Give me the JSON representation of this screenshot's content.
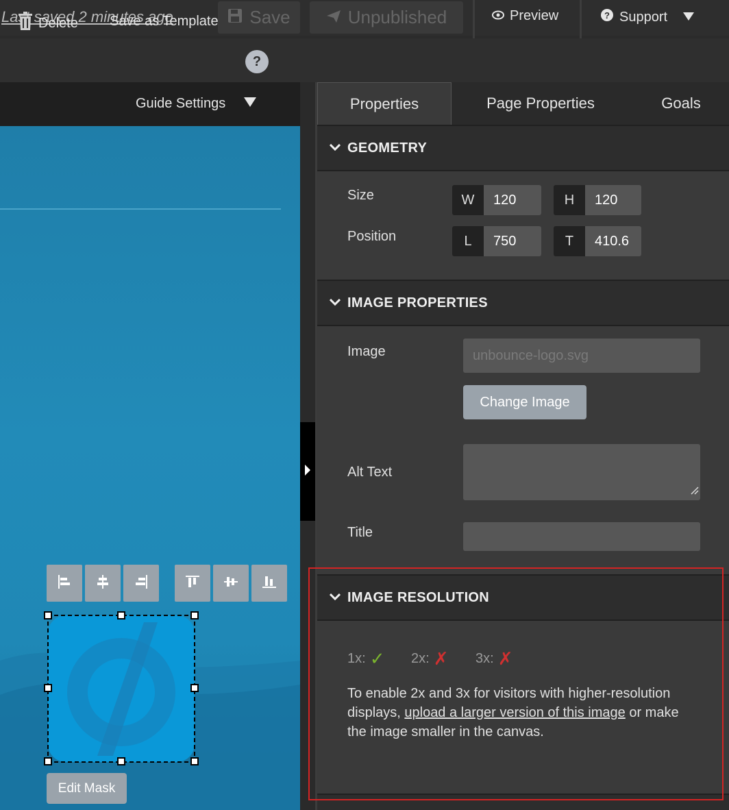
{
  "topbar": {
    "last_saved": "Last saved  2 minutes ago",
    "save_label": "Save",
    "unpublished_label": "Unpublished",
    "preview_label": "Preview",
    "support_label": "Support"
  },
  "toolbar": {
    "delete_label": "Delete",
    "save_template_label": "Save as Template",
    "help_label": "?"
  },
  "canvas": {
    "guide_settings_label": "Guide Settings",
    "edit_mask_label": "Edit Mask"
  },
  "tabs": [
    {
      "label": "Properties",
      "active": true
    },
    {
      "label": "Page Properties",
      "active": false
    },
    {
      "label": "Goals",
      "active": false
    }
  ],
  "geometry": {
    "heading": "GEOMETRY",
    "size_label": "Size",
    "position_label": "Position",
    "w_key": "W",
    "w_value": "120",
    "h_key": "H",
    "h_value": "120",
    "l_key": "L",
    "l_value": "750",
    "t_key": "T",
    "t_value": "410.6"
  },
  "image_properties": {
    "heading": "IMAGE PROPERTIES",
    "image_label": "Image",
    "image_placeholder": "unbounce-logo.svg",
    "change_image_label": "Change Image",
    "alt_text_label": "Alt Text",
    "title_label": "Title"
  },
  "image_resolution": {
    "heading": "IMAGE RESOLUTION",
    "res_1x": "1x:",
    "res_2x": "2x:",
    "res_3x": "3x:",
    "text_before": "To enable 2x and 3x for visitors with higher-resolution displays, ",
    "text_link": "upload a larger version of this image",
    "text_after": " or make the image smaller in the canvas."
  },
  "colors": {
    "highlight_border": "#d42424",
    "check_green": "#7ab32e",
    "cross_red": "#d03030",
    "logo_blue": "#0a98d8"
  }
}
